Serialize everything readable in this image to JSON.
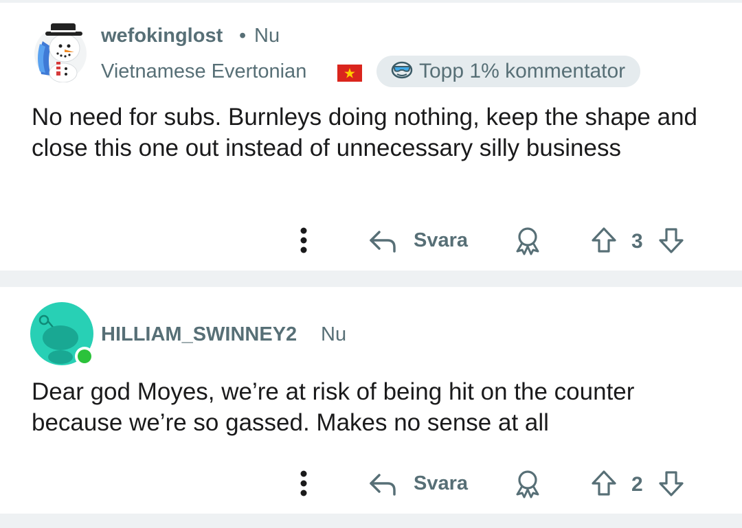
{
  "comments": [
    {
      "username": "wefokinglost",
      "separator": "•",
      "time": "Nu",
      "flair_text": "Vietnamese Evertonian",
      "flair_icon": "vietnam-flag-icon",
      "badge": "Topp 1% kommentator",
      "badge_icon": "sunglasses-snoo-icon",
      "body": "No need for subs. Burnleys doing nothing, keep the shape and close this one out instead of unnecessary silly business",
      "reply_label": "Svara",
      "votes": "3",
      "online": false
    },
    {
      "username": "HILLIAM_SWINNEY2",
      "time": "Nu",
      "body": "Dear god Moyes, we’re at risk of being hit on the counter because we’re so gassed. Makes no sense at all",
      "reply_label": "Svara",
      "votes": "2",
      "online": true
    }
  ],
  "colors": {
    "meta": "#576f76",
    "text": "#1a1a1b",
    "badge_bg": "#e5ebee",
    "separator_bg": "#eef1f3",
    "avatar_teal": "#28d0b5",
    "online_green": "#2bc23b",
    "flag_red": "#da251d",
    "flag_star": "#ffcd00"
  }
}
